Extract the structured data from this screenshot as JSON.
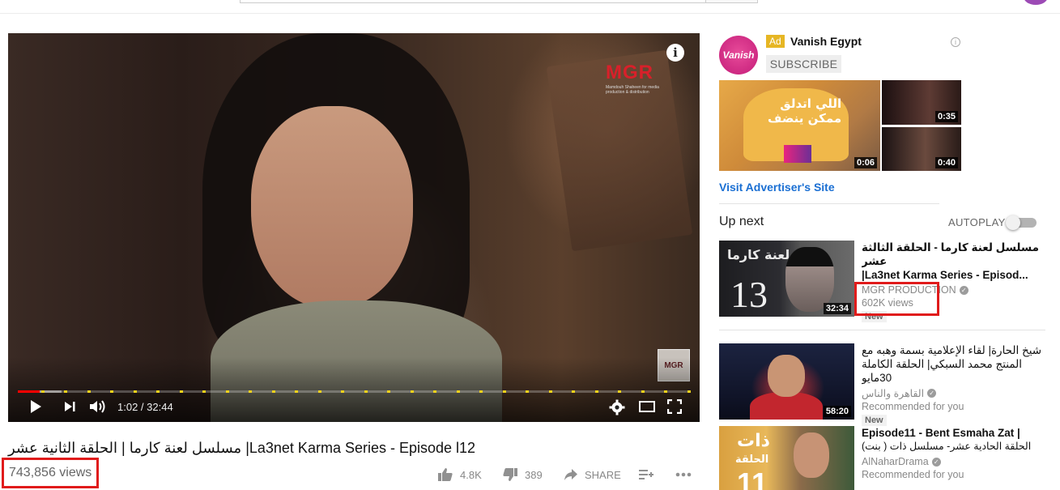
{
  "player": {
    "time_current": "1:02",
    "time_total": "32:44",
    "time_display": "1:02 / 32:44",
    "progress_fraction": 0.032,
    "buffered_fraction": 0.065,
    "logo_text": "MGR",
    "logo_subtext": "Mamdouh Shaheen for media production & distribution",
    "watermark_text": "MGR"
  },
  "video": {
    "title": "مسلسل لعنة كارما | الحلقة الثانية عشر |La3net Karma Series - Episode l12",
    "views": "743,856 views",
    "likes": "4.8K",
    "dislikes": "389",
    "share_label": "SHARE"
  },
  "ad": {
    "badge": "Ad",
    "advertiser": "Vanish Egypt",
    "avatar_text": "Vanish",
    "subscribe_label": "SUBSCRIBE",
    "thumb_durations": [
      "0:06",
      "0:35",
      "0:40"
    ],
    "visit_link": "Visit Advertiser's Site"
  },
  "up_next": {
    "heading": "Up next",
    "autoplay_label": "AUTOPLAY",
    "autoplay_on": false
  },
  "recommendations": [
    {
      "title_line1": "مسلسل لعنة كارما - الحلقة الثالثة عشر",
      "title_line2": "|La3net Karma Series - Episod...",
      "channel": "MGR PRODUCTION",
      "verified": true,
      "line2": "602K views",
      "badge": "New",
      "duration": "32:34"
    },
    {
      "title_line1": "شيخ الحارة| لقاء الإعلامية بسمة وهبه مع",
      "title_line2": "المنتج محمد السبكي| الحلقة الكاملة 30مايو",
      "channel": "القاهرة والناس",
      "verified": true,
      "line2": "Recommended for you",
      "badge": "New",
      "duration": "58:20"
    },
    {
      "title_line1": "Episode11 - Bent Esmaha Zat |",
      "title_line2": "الحلقة الحادية عشر- مسلسل ذات ( بنت)",
      "channel": "AlNaharDrama",
      "verified": true,
      "line2": "Recommended for you",
      "badge": "",
      "duration": ""
    }
  ],
  "colors": {
    "progress": "#ff0000",
    "ad_marker": "#f2d21c",
    "highlight": "#e01b1b",
    "link": "#1a6fd3",
    "ad_badge": "#e6b624"
  }
}
